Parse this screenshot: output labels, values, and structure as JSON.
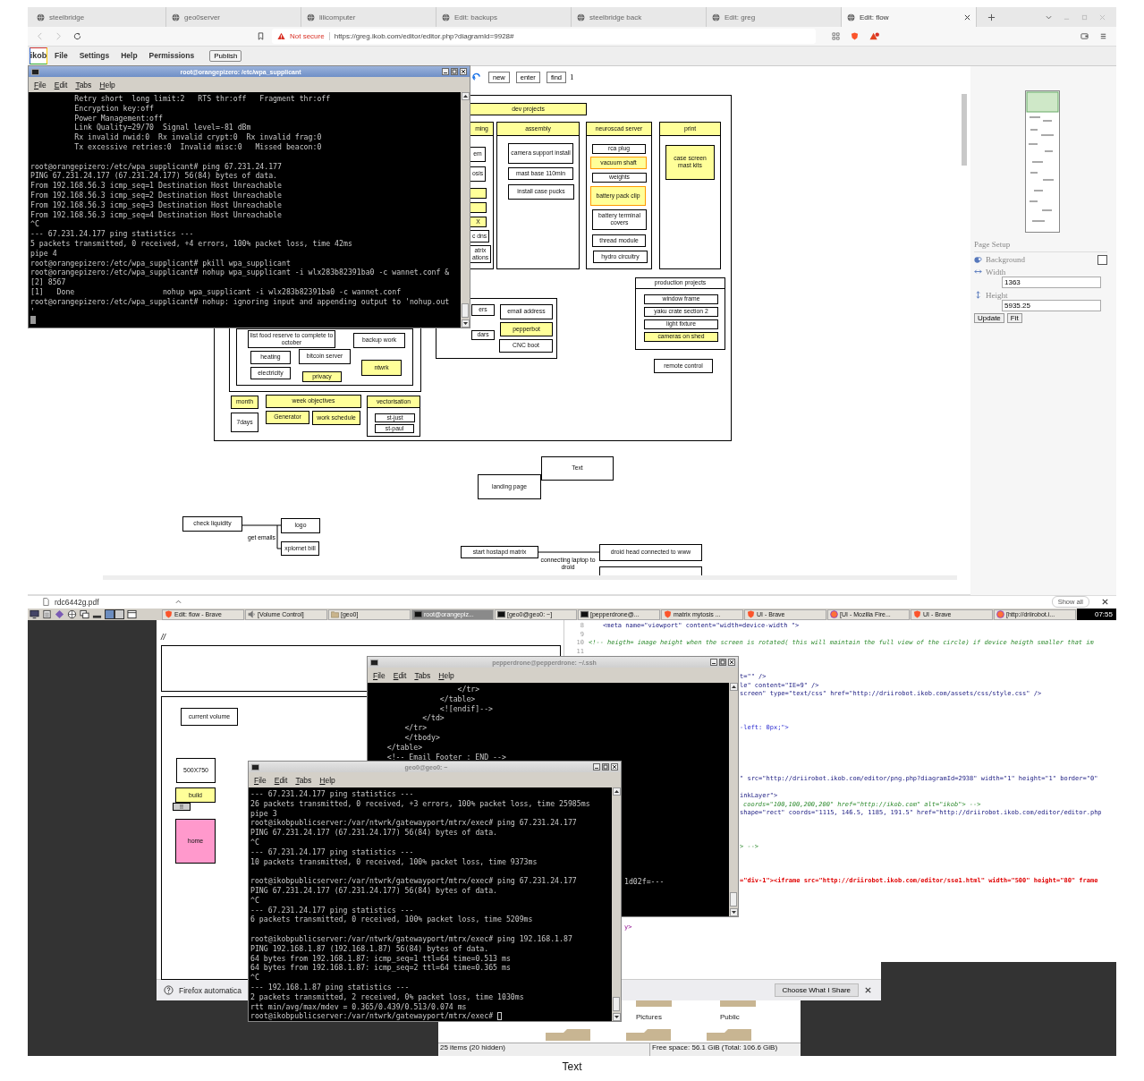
{
  "browser": {
    "tabs": [
      {
        "title": "steelbridge",
        "selected": false
      },
      {
        "title": "geo0server",
        "selected": false
      },
      {
        "title": "lilicomputer",
        "selected": false
      },
      {
        "title": "Edit: backups",
        "selected": false
      },
      {
        "title": "steelbridge back",
        "selected": false
      },
      {
        "title": "Edit: greg",
        "selected": false
      },
      {
        "title": "Edit: flow",
        "selected": true
      }
    ],
    "security": "Not secure",
    "url": "https://greg.ikob.com/editor/editor.php?diagramId=9928#"
  },
  "app_menu": {
    "logo": "ikob",
    "items": [
      "File",
      "Settings",
      "Help",
      "Permissions"
    ],
    "publish": "Publish"
  },
  "toolbar": {
    "buttons": [
      "new",
      "enter",
      "find"
    ],
    "page": "1"
  },
  "diagram": {
    "nodes": [
      {
        "text": "dev projects",
        "kind": "node",
        "color": "#ffff99"
      },
      {
        "text": "ming",
        "kind": "node",
        "color": "#ffff99"
      },
      {
        "text": "em",
        "kind": "node",
        "color": "#ffffff"
      },
      {
        "text": "osis",
        "kind": "node",
        "color": "#ffffff"
      },
      {
        "text": "X",
        "kind": "node",
        "color": "#ffff99"
      },
      {
        "text": "c dns",
        "kind": "node",
        "color": "#ffffff"
      },
      {
        "text": "atrix ations",
        "kind": "node",
        "color": "#ffffff"
      },
      {
        "text": "assembly",
        "kind": "node",
        "color": "#ffff99"
      },
      {
        "text": "camera support install",
        "kind": "node",
        "color": "#ffffff"
      },
      {
        "text": "mast base 110min",
        "kind": "node",
        "color": "#ffffff"
      },
      {
        "text": "install case pucks",
        "kind": "node",
        "color": "#ffffff"
      },
      {
        "text": "neuroscad server",
        "kind": "node",
        "color": "#ffff99"
      },
      {
        "text": "rca plug",
        "kind": "node",
        "color": "#ffffff"
      },
      {
        "text": "vacuum shaft",
        "kind": "flagged",
        "color": "#ffff99"
      },
      {
        "text": "weights",
        "kind": "node",
        "color": "#ffffff"
      },
      {
        "text": "battery pack clip",
        "kind": "flagged",
        "color": "#ffff99"
      },
      {
        "text": "battery terminal covers",
        "kind": "node",
        "color": "#ffffff"
      },
      {
        "text": "thread module",
        "kind": "node",
        "color": "#ffffff"
      },
      {
        "text": "hydro circuitry",
        "kind": "node",
        "color": "#ffffff"
      },
      {
        "text": "print",
        "kind": "node",
        "color": "#ffff99"
      },
      {
        "text": "case screen mast kits",
        "kind": "node",
        "color": "#ffff99"
      },
      {
        "text": "production projects",
        "kind": "node",
        "color": "#ffffff"
      },
      {
        "text": "window frame",
        "kind": "node",
        "color": "#ffffff"
      },
      {
        "text": "yaku crate section 2",
        "kind": "node",
        "color": "#ffffff"
      },
      {
        "text": "light fixture",
        "kind": "node",
        "color": "#ffffff"
      },
      {
        "text": "cameras on shed",
        "kind": "node",
        "color": "#ffff99"
      },
      {
        "text": "remote control",
        "kind": "node",
        "color": "#ffffff"
      },
      {
        "text": "ers",
        "kind": "node",
        "color": "#ffffff"
      },
      {
        "text": "dars",
        "kind": "node",
        "color": "#ffffff"
      },
      {
        "text": "email address",
        "kind": "node",
        "color": "#ffffff"
      },
      {
        "text": "pepperbot",
        "kind": "node",
        "color": "#ffff99"
      },
      {
        "text": "CNC boot",
        "kind": "node",
        "color": "#ffffff"
      },
      {
        "text": "list food reserve to complete to october",
        "kind": "node",
        "color": "#ffffff"
      },
      {
        "text": "backup work",
        "kind": "node",
        "color": "#ffffff"
      },
      {
        "text": "heating",
        "kind": "node",
        "color": "#ffffff"
      },
      {
        "text": "bitcoin server",
        "kind": "node",
        "color": "#ffffff"
      },
      {
        "text": "electricity",
        "kind": "node",
        "color": "#ffffff"
      },
      {
        "text": "privacy",
        "kind": "node",
        "color": "#ffff99"
      },
      {
        "text": "ntwrk",
        "kind": "node",
        "color": "#ffff99"
      },
      {
        "text": "month",
        "kind": "node",
        "color": "#ffff99"
      },
      {
        "text": "7days",
        "kind": "node",
        "color": "#ffffff"
      },
      {
        "text": "week objectives",
        "kind": "node",
        "color": "#ffff99"
      },
      {
        "text": "Generator",
        "kind": "node",
        "color": "#ffff99"
      },
      {
        "text": "work schedule",
        "kind": "node",
        "color": "#ffff99"
      },
      {
        "text": "vectorisation",
        "kind": "node",
        "color": "#ffff99"
      },
      {
        "text": "st-just",
        "kind": "node",
        "color": "#ffffff"
      },
      {
        "text": "st-paul",
        "kind": "node",
        "color": "#ffffff"
      },
      {
        "text": "Text",
        "kind": "node",
        "color": "#ffffff"
      },
      {
        "text": "landing page",
        "kind": "node",
        "color": "#ffffff"
      },
      {
        "text": "check liquidity",
        "kind": "node",
        "color": "#ffffff"
      },
      {
        "text": "logo",
        "kind": "node",
        "color": "#ffffff"
      },
      {
        "text": "xplornet bill",
        "kind": "node",
        "color": "#ffffff"
      },
      {
        "text": "start hostapd matrix",
        "kind": "node",
        "color": "#ffffff"
      },
      {
        "text": "droid head connected to www",
        "kind": "node",
        "color": "#ffffff"
      },
      {
        "text": "get emails",
        "kind": "label"
      },
      {
        "text": "connecting laptop to droid",
        "kind": "label"
      }
    ]
  },
  "page_setup": {
    "title": "Page Setup",
    "background": {
      "label": "Background",
      "checked": false
    },
    "width": {
      "label": "Width",
      "value": "1363"
    },
    "height": {
      "label": "Height",
      "value": "5935.25"
    },
    "buttons": [
      "Update",
      "Fit"
    ]
  },
  "download_bar": {
    "file": "rdc6442g.pdf",
    "show_all": "Show all"
  },
  "terminal_top": {
    "title": "root@orangepizero: /etc/wpa_supplicant",
    "active": true,
    "cursor": {
      "kind": "block"
    },
    "menu": [
      "File",
      "Edit",
      "Tabs",
      "Help"
    ],
    "blocks": [
      [
        "          Retry short  long limit:2   RTS thr:off   Fragment thr:off",
        "          Encryption key:off",
        "          Power Management:off",
        "          Link Quality=29/70  Signal level=-81 dBm",
        "          Rx invalid nwid:0  Rx invalid crypt:0  Rx invalid frag:0",
        "          Tx excessive retries:0  Invalid misc:0   Missed beacon:0"
      ],
      [
        "root@orangepizero:/etc/wpa_supplicant# ping 67.231.24.177",
        "PING 67.231.24.177 (67.231.24.177) 56(84) bytes of data.",
        "From 192.168.56.3 icmp_seq=1 Destination Host Unreachable",
        "From 192.168.56.3 icmp_seq=2 Destination Host Unreachable",
        "From 192.168.56.3 icmp_seq=3 Destination Host Unreachable",
        "From 192.168.56.3 icmp_seq=4 Destination Host Unreachable",
        "^C",
        "--- 67.231.24.177 ping statistics ---",
        "5 packets transmitted, 0 received, +4 errors, 100% packet loss, time 42ms",
        "pipe 4",
        "root@orangepizero:/etc/wpa_supplicant# pkill wpa_supplicant",
        "root@orangepizero:/etc/wpa_supplicant# nohup wpa_supplicant -i wlx283b82391ba0 -c wannet.conf &",
        "[2] 8567",
        "[1]   Done                    nohup wpa_supplicant -i wlx283b82391ba0 -c wannet.conf",
        "root@orangepizero:/etc/wpa_supplicant# nohup: ignoring input and appending output to 'nohup.out",
        "'"
      ]
    ]
  },
  "taskbar": {
    "items": [
      {
        "label": "Edit: flow - Brave",
        "kind": "brave",
        "selected": false
      },
      {
        "label": "[Volume Control]",
        "kind": "volume",
        "selected": false
      },
      {
        "label": "[geo0]",
        "kind": "folder",
        "selected": false
      },
      {
        "label": "root@orangepiz...",
        "kind": "terminal",
        "selected": true
      },
      {
        "label": "[geo0@geo0: ~]",
        "kind": "terminal",
        "selected": false
      },
      {
        "label": "[pepperdrone@...",
        "kind": "terminal",
        "selected": false
      },
      {
        "label": "matrix mytosis ...",
        "kind": "brave",
        "selected": false
      },
      {
        "label": "UI - Brave",
        "kind": "brave",
        "selected": false
      },
      {
        "label": "[UI - Mozilla Fire...",
        "kind": "firefox",
        "selected": false
      },
      {
        "label": "UI - Brave",
        "kind": "brave",
        "selected": false
      },
      {
        "label": "[http://driirobot.i...",
        "kind": "firefox",
        "selected": false
      }
    ],
    "clock": "07:55"
  },
  "firefox": {
    "slashes": "//",
    "nodes": [
      {
        "text": "current volume",
        "color": "#ffffff"
      },
      {
        "text": "500X750",
        "color": "#ffffff"
      },
      {
        "text": "build",
        "color": "#ffff99"
      },
      {
        "text": "!!",
        "color": "#cccccc"
      },
      {
        "text": "home",
        "color": "#ff99cc"
      }
    ],
    "notification": {
      "text": "Firefox automatica",
      "button": "Choose What I Share"
    }
  },
  "code_editor": {
    "lines": [
      {
        "number": "8",
        "text": "<meta name=\"viewport\" content=\"width=device-width \">",
        "kind": "markup"
      },
      {
        "number": "9"
      },
      {
        "number": "10",
        "text": "<!-- heigth= image height when the screen is rotated( this will maintain the full view of the circle) if device heigth smaller that im",
        "kind": "comment"
      },
      {
        "number": "11"
      },
      {
        "text": "t=\"\" />",
        "kind": "markup"
      },
      {
        "text": "le\" content=\"IE=9\" />",
        "kind": "markup"
      },
      {
        "text": "screen\" type=\"text/css\" href=\"http://driirobot.ikob.com/assets/css/style.css\" />",
        "kind": "markup"
      },
      {
        "text": "-left: 0px;\">",
        "kind": "style"
      },
      {
        "text": "\" src=\"http://driirobot.ikob.com/editor/png.php?diagramId=2938\" width=\"1\" height=\"1\" border=\"0\"",
        "kind": "markup"
      },
      {
        "text": "inkLayer\">",
        "kind": "markup"
      },
      {
        "text": "coords=\"100,100,200,200\" href=\"http://ikob.com\" alt=\"ikob\"> -->",
        "kind": "comment"
      },
      {
        "text": "shape=\"rect\" coords=\"1115, 146.5, 1185, 191.5\" href=\"http://driirobot.ikob.com/editor/editor.php",
        "kind": "markup"
      },
      {
        "text": "> -->",
        "kind": "comment"
      },
      {
        "text": "=\"div-1\"><iframe src=\"http://driirobot.ikob.com/editor/sse1.html\" width=\"500\" height=\"80\" frame",
        "kind": "error"
      },
      {
        "text": "y>",
        "kind": "tag"
      }
    ]
  },
  "terminal_pepper": {
    "title": "pepperdrone@pepperdrone: ~/.ssh",
    "active": false,
    "menu": [
      "File",
      "Edit",
      "Tabs",
      "Help"
    ],
    "blocks": [
      [
        "                    </tr>",
        "                </table>",
        "                <![endif]-->",
        "            </td>",
        "        </tr>",
        "        </tbody>",
        "    </table>",
        "    <!-- Email Footer : END -->"
      ],
      [
        "1d02f=---"
      ]
    ]
  },
  "terminal_geo": {
    "title": "geo0@geo0: ~",
    "active": false,
    "cursor": {
      "kind": "outline"
    },
    "menu": [
      "File",
      "Edit",
      "Tabs",
      "Help"
    ],
    "blocks": [
      [
        "--- 67.231.24.177 ping statistics ---",
        "26 packets transmitted, 0 received, +3 errors, 100% packet loss, time 25985ms",
        "pipe 3",
        "root@ikobpublicserver:/var/ntwrk/gatewayport/mtrx/exec# ping 67.231.24.177",
        "PING 67.231.24.177 (67.231.24.177) 56(84) bytes of data.",
        "^C",
        "--- 67.231.24.177 ping statistics ---",
        "10 packets transmitted, 0 received, 100% packet loss, time 9373ms"
      ],
      [
        "root@ikobpublicserver:/var/ntwrk/gatewayport/mtrx/exec# ping 67.231.24.177",
        "PING 67.231.24.177 (67.231.24.177) 56(84) bytes of data.",
        "^C",
        "--- 67.231.24.177 ping statistics ---",
        "6 packets transmitted, 0 received, 100% packet loss, time 5209ms"
      ],
      [
        "root@ikobpublicserver:/var/ntwrk/gatewayport/mtrx/exec# ping 192.168.1.87",
        "PING 192.168.1.87 (192.168.1.87) 56(84) bytes of data.",
        "64 bytes from 192.168.1.87: icmp_seq=1 ttl=64 time=0.513 ms",
        "64 bytes from 192.168.1.87: icmp_seq=2 ttl=64 time=0.365 ms",
        "^C",
        "--- 192.168.1.87 ping statistics ---",
        "2 packets transmitted, 2 received, 0% packet loss, time 1030ms",
        "rtt min/avg/max/mdev = 0.365/0.439/0.513/0.074 ms",
        "root@ikobpublicserver:/var/ntwrk/gatewayport/mtrx/exec#"
      ]
    ]
  },
  "file_manager": {
    "folders": [
      "Pictures",
      "Public"
    ],
    "status": "25 items (20 hidden)",
    "free_space": "Free space: 56.1 GiB (Total: 106.6 GiB)"
  },
  "caption": "Text"
}
